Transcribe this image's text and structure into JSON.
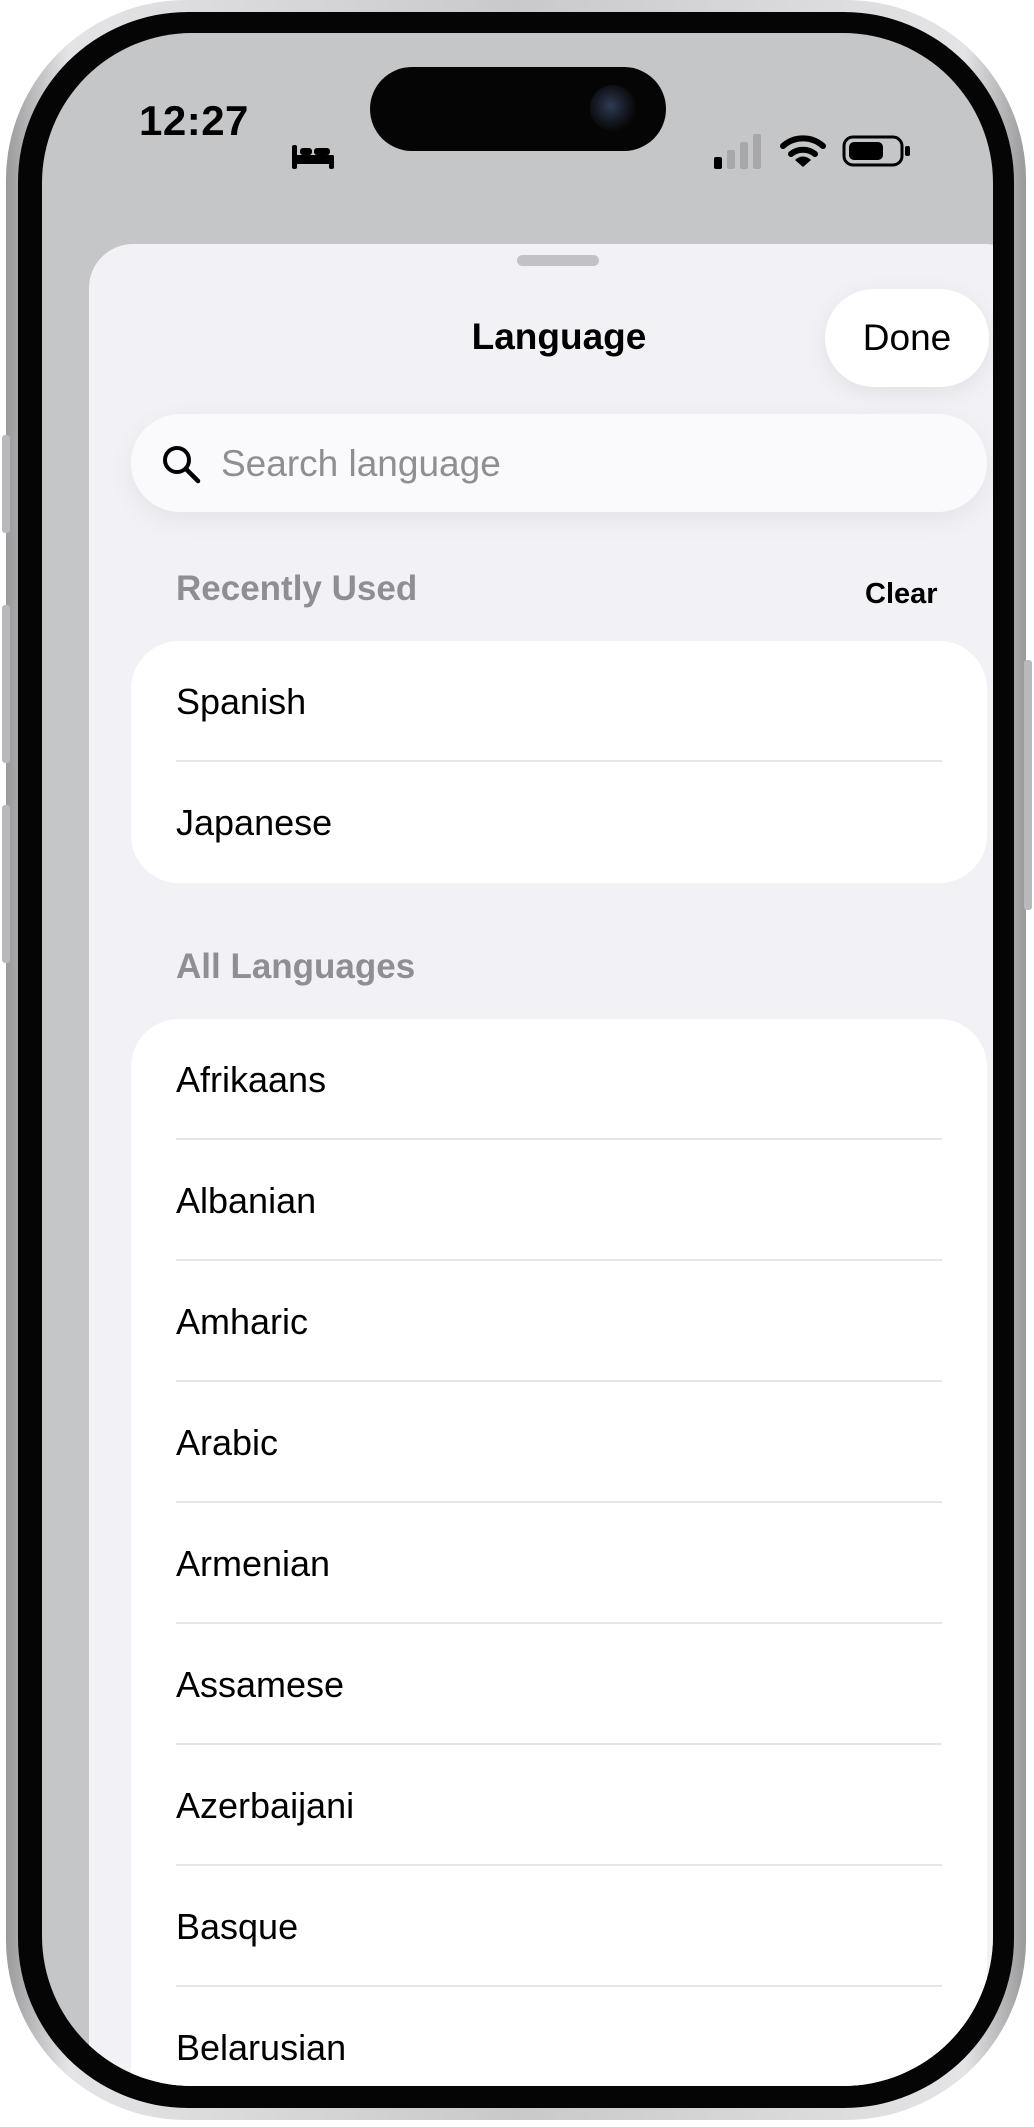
{
  "status_bar": {
    "time": "12:27",
    "focus_icon": "bed-icon",
    "signal_icon": "cellular-signal-icon",
    "wifi_icon": "wifi-icon",
    "battery_icon": "battery-icon"
  },
  "sheet": {
    "title": "Language",
    "done_label": "Done"
  },
  "search": {
    "placeholder": "Search language",
    "value": "",
    "icon": "search-icon"
  },
  "recent": {
    "header": "Recently Used",
    "clear_label": "Clear",
    "items": [
      "Spanish",
      "Japanese"
    ]
  },
  "all_languages": {
    "header": "All Languages",
    "items": [
      "Afrikaans",
      "Albanian",
      "Amharic",
      "Arabic",
      "Armenian",
      "Assamese",
      "Azerbaijani",
      "Basque",
      "Belarusian"
    ]
  },
  "colors": {
    "sheet_background": "#f2f2f6",
    "card_background": "#ffffff",
    "secondary_text": "#8e8e93",
    "separator": "#e5e5ea"
  }
}
